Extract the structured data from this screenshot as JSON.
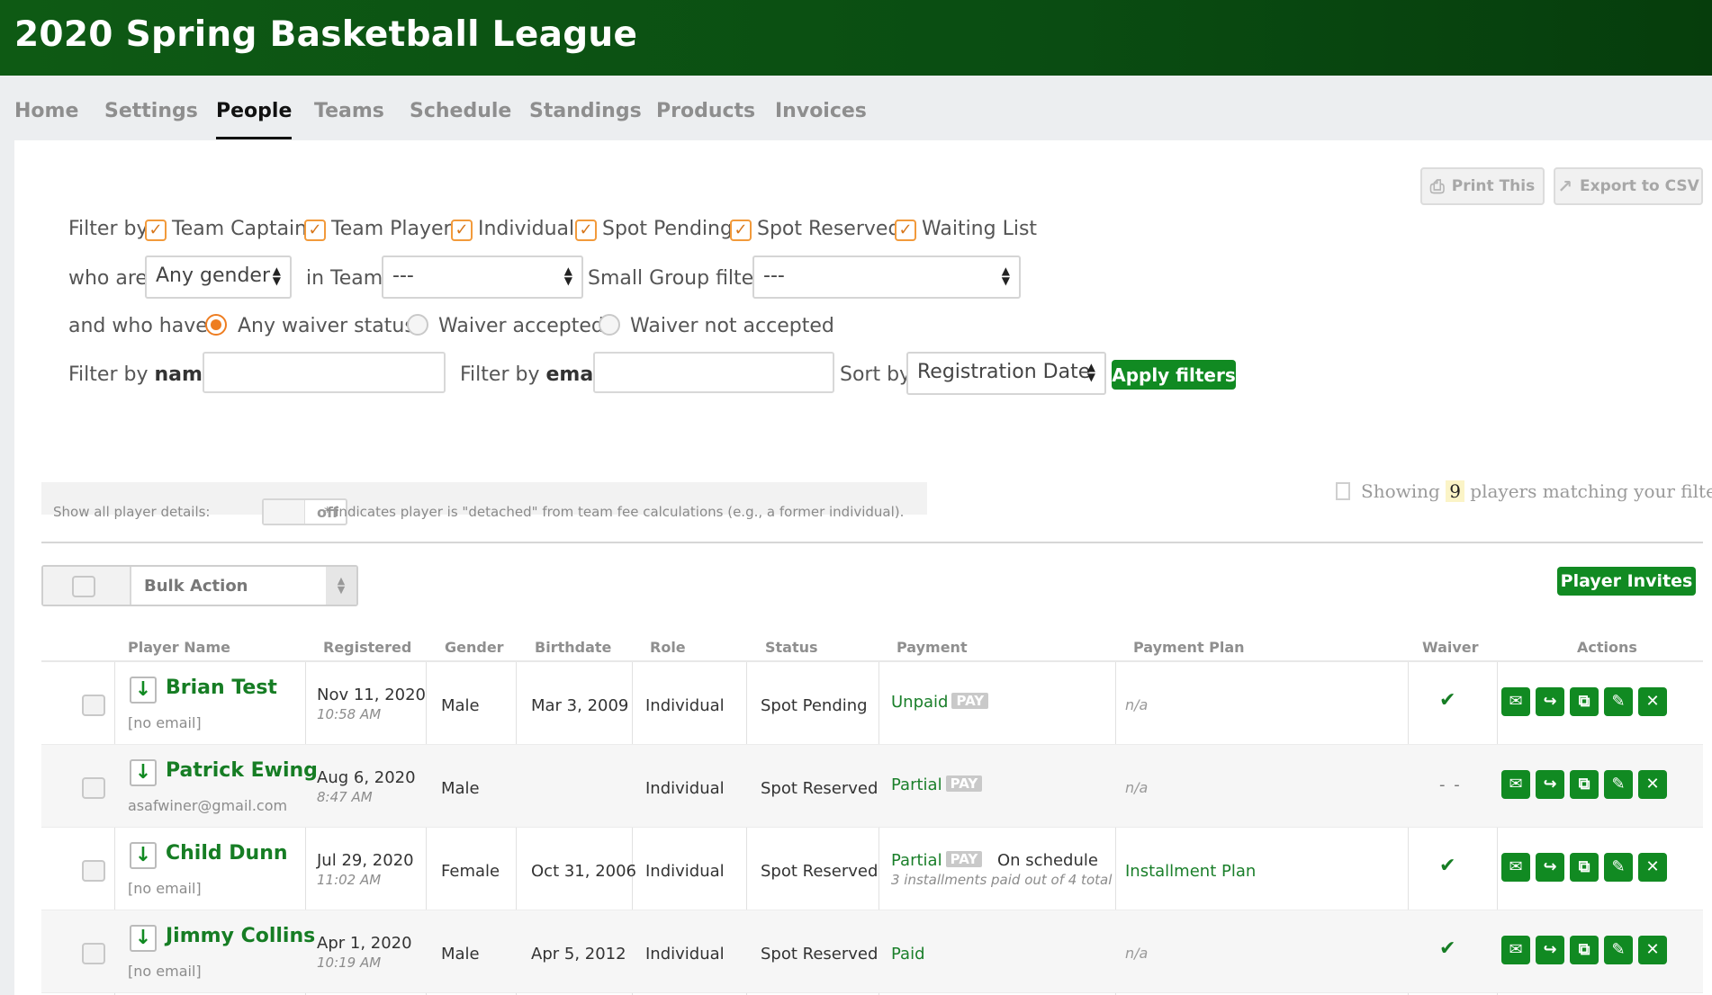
{
  "header": {
    "title": "2020 Spring Basketball League"
  },
  "nav": [
    "Home",
    "Settings",
    "People",
    "Teams",
    "Schedule",
    "Standings",
    "Products",
    "Invoices"
  ],
  "toolbar": {
    "print": "Print This",
    "export": "Export to CSV"
  },
  "filters": {
    "filter_by": "Filter by",
    "roles": [
      "Team Captain",
      "Team Player",
      "Individual",
      "Spot Pending",
      "Spot Reserved",
      "Waiting List"
    ],
    "who_are": "who are",
    "gender_value": "Any gender",
    "in_team": "in Team",
    "team_value": "---",
    "small_group": "Small Group filter:",
    "small_group_value": "---",
    "and_who_have": "and who have",
    "waiver_options": [
      "Any waiver status",
      "Waiver accepted",
      "Waiver not accepted"
    ],
    "filter_by_name_prefix": "Filter by",
    "filter_by_name_bold": "name",
    "name_value": "",
    "filter_by_email_prefix": "Filter by",
    "filter_by_email_bold": "email",
    "email_value": "",
    "sort_by": "Sort by",
    "sort_value": "Registration Date",
    "apply": "Apply filters"
  },
  "details": {
    "label": "Show all player details:",
    "toggle": "off",
    "note": "* indicates player is \"detached\" from team fee calculations (e.g., a former individual)."
  },
  "showing": {
    "prefix": "Showing",
    "count": "9",
    "suffix": "players matching your filters."
  },
  "bulk": {
    "label": "Bulk Action"
  },
  "player_invites": "Player Invites",
  "table": {
    "headers": [
      "Player Name",
      "Registered",
      "Gender",
      "Birthdate",
      "Role",
      "Status",
      "Payment",
      "Payment Plan",
      "Waiver",
      "Actions"
    ],
    "pay_label": "PAY",
    "rows": [
      {
        "name": "Brian Test",
        "email": "[no email]",
        "date": "Nov 11, 2020",
        "time": "10:58 AM",
        "gender": "Male",
        "birthdate": "Mar 3, 2009",
        "role": "Individual",
        "status": "Spot Pending",
        "payment": "Unpaid",
        "schedule": "",
        "installments": "",
        "plan": "n/a",
        "waiver": "✔"
      },
      {
        "name": "Patrick Ewing",
        "email": "asafwiner@gmail.com",
        "date": "Aug 6, 2020",
        "time": "8:47 AM",
        "gender": "Male",
        "birthdate": "",
        "role": "Individual",
        "status": "Spot Reserved",
        "payment": "Partial",
        "schedule": "",
        "installments": "",
        "plan": "n/a",
        "waiver": "- -"
      },
      {
        "name": "Child Dunn",
        "email": "[no email]",
        "date": "Jul 29, 2020",
        "time": "11:02 AM",
        "gender": "Female",
        "birthdate": "Oct 31, 2006",
        "role": "Individual",
        "status": "Spot Reserved",
        "payment": "Partial",
        "schedule": "On schedule",
        "installments": "3 installments paid out of 4 total",
        "plan": "Installment Plan",
        "waiver": "✔"
      },
      {
        "name": "Jimmy Collins",
        "email": "[no email]",
        "date": "Apr 1, 2020",
        "time": "10:19 AM",
        "gender": "Male",
        "birthdate": "Apr 5, 2012",
        "role": "Individual",
        "status": "Spot Reserved",
        "payment": "Paid",
        "schedule": "",
        "installments": "",
        "plan": "n/a",
        "waiver": "✔"
      }
    ]
  }
}
